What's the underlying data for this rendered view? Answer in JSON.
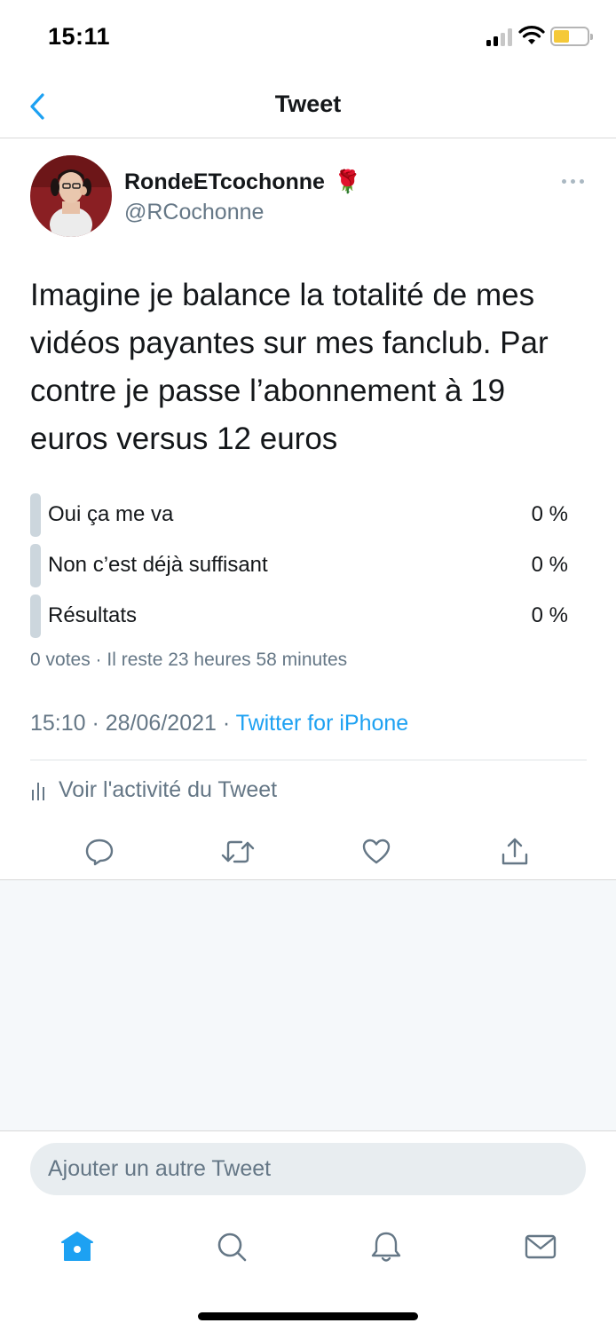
{
  "status_bar": {
    "time": "15:11"
  },
  "nav": {
    "title": "Tweet"
  },
  "tweet": {
    "display_name": "RondeETcochonne",
    "name_emoji": "🌹",
    "handle": "@RCochonne",
    "text": "Imagine je balance la totalité de mes vidéos payantes sur mes fanclub. Par contre je passe l’abonnement à 19 euros versus 12 euros",
    "poll": {
      "options": [
        {
          "label": "Oui ça me va",
          "percent": "0 %"
        },
        {
          "label": "Non c’est déjà suffisant",
          "percent": "0 %"
        },
        {
          "label": "Résultats",
          "percent": "0 %"
        }
      ],
      "meta": "0 votes · Il reste 23 heures 58 minutes"
    },
    "timestamp": "15:10 · 28/06/2021 · ",
    "source": "Twitter for iPhone",
    "activity_label": "Voir l'activité du Tweet"
  },
  "compose": {
    "placeholder": "Ajouter un autre Tweet"
  },
  "icons": {
    "back": "chevron-left-icon",
    "more": "more-horizontal-icon",
    "activity": "bar-chart-icon",
    "reply": "reply-icon",
    "retweet": "retweet-icon",
    "like": "heart-icon",
    "share": "share-icon",
    "home": "home-icon",
    "search": "search-icon",
    "notifications": "bell-icon",
    "messages": "mail-icon"
  },
  "colors": {
    "accent": "#1da1f2",
    "secondary_text": "#657786",
    "primary_text": "#14171a",
    "poll_bar": "#ccd6dd",
    "battery": "#f5c938"
  }
}
